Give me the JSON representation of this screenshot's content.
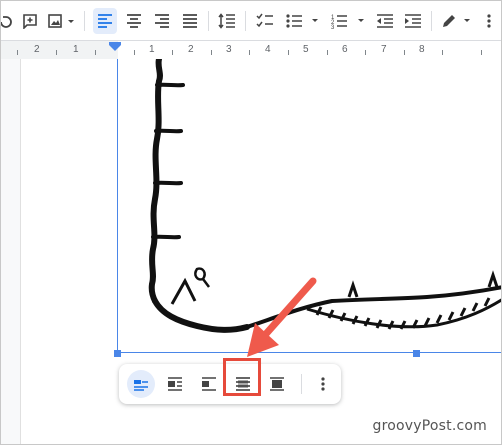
{
  "ruler": {
    "labels": [
      "2",
      "1",
      "1",
      "2",
      "3",
      "4",
      "5",
      "6",
      "7",
      "8"
    ]
  },
  "toolbar": {
    "buttons": [
      "undo-icon",
      "add-comment-icon",
      "insert-image-icon",
      "align-left-icon",
      "align-center-icon",
      "align-right-icon",
      "justify-icon",
      "line-spacing-icon",
      "checklist-icon",
      "bulleted-list-icon",
      "numbered-list-icon",
      "decrease-indent-icon",
      "increase-indent-icon",
      "pen-icon",
      "more-icon"
    ],
    "active": "align-left-icon"
  },
  "image_options": {
    "buttons": [
      "in-line-icon",
      "wrap-text-icon",
      "break-text-icon",
      "behind-text-icon",
      "in-front-of-text-icon",
      "more-options-icon"
    ],
    "selected": "in-line-icon",
    "highlighted": "behind-text-icon"
  },
  "colors": {
    "accent": "#4a86e8",
    "highlight": "#e64a3b",
    "arrow": "#ef5a4c"
  },
  "watermark": "groovyPost.com"
}
